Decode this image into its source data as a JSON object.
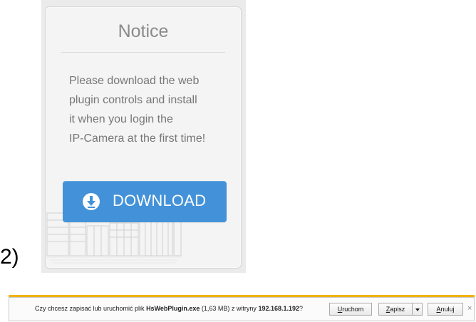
{
  "notice_card": {
    "title": "Notice",
    "message_lines": [
      "Please download the web",
      "plugin controls and install",
      "it when you login the",
      "IP-Camera at the first time!"
    ],
    "download_button_label": "DOWNLOAD",
    "download_icon": "download-arrow-icon"
  },
  "step_label": "2)",
  "download_bar": {
    "prompt_prefix": "Czy chcesz zapisać lub uruchomić plik ",
    "file_name": "HsWebPlugin.exe",
    "file_size": " (1,63 MB) z witryny ",
    "site": "192.168.1.192",
    "prompt_suffix": "?",
    "run_button": {
      "accel": "U",
      "rest": "ruchom"
    },
    "save_button": {
      "accel": "Z",
      "rest": "apisz"
    },
    "cancel_button": {
      "accel": "A",
      "rest": "nuluj"
    },
    "close_glyph": "×",
    "accent_color": "#f0b400"
  }
}
